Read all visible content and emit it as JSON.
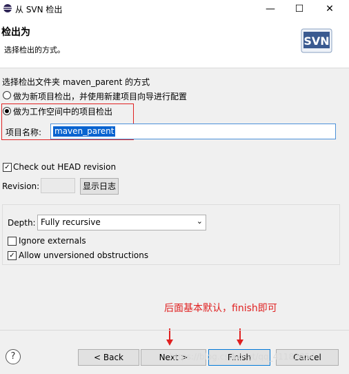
{
  "window": {
    "title": "从 SVN 检出",
    "minimize": "—",
    "maximize": "☐",
    "close": "✕"
  },
  "header": {
    "title": "检出为",
    "description": "选择检出的方式。",
    "logo_text": "SVN"
  },
  "options": {
    "heading": "选择检出文件夹 maven_parent 的方式",
    "radio_new_project": "做为新项目检出，并使用新建项目向导进行配置",
    "radio_workspace_project": "做为工作空间中的项目检出",
    "project_name_label": "项目名称:",
    "project_name_value": "maven_parent",
    "selected": "workspace"
  },
  "revision": {
    "check_head_label": "Check out HEAD revision",
    "check_head_checked": true,
    "revision_label": "Revision:",
    "revision_value": "",
    "show_log_button": "显示日志"
  },
  "depth": {
    "depth_label": "Depth:",
    "depth_value": "Fully recursive",
    "ignore_externals_label": "Ignore externals",
    "ignore_externals_checked": false,
    "allow_unversioned_label": "Allow unversioned obstructions",
    "allow_unversioned_checked": true
  },
  "annotation": {
    "note": "后面基本默认，finish即可",
    "color": "#e02020"
  },
  "footer": {
    "help": "?",
    "back": "< Back",
    "next": "Next >",
    "finish": "Finish",
    "cancel": "Cancel",
    "watermark": "https://blog.csdn.net/qq_41182854"
  }
}
